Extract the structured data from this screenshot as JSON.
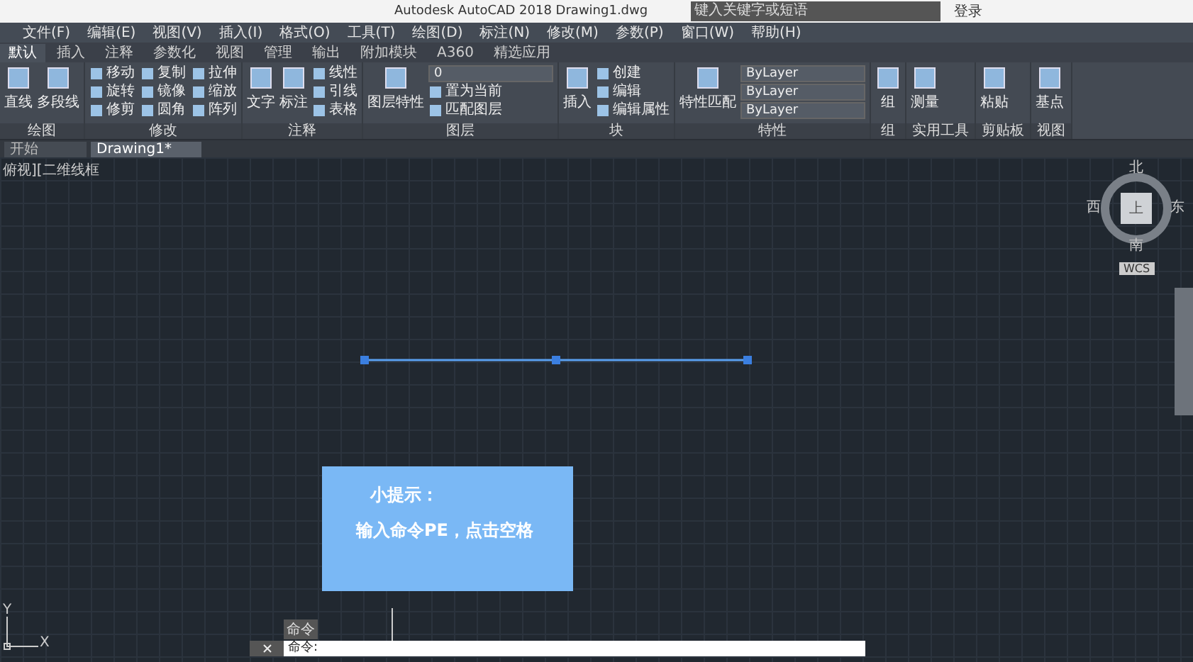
{
  "title_bar": {
    "title": "Autodesk AutoCAD 2018    Drawing1.dwg",
    "search_placeholder": "键入关键字或短语",
    "user": "登录"
  },
  "menu": [
    "文件(F)",
    "编辑(E)",
    "视图(V)",
    "插入(I)",
    "格式(O)",
    "工具(T)",
    "绘图(D)",
    "标注(N)",
    "修改(M)",
    "参数(P)",
    "窗口(W)",
    "帮助(H)"
  ],
  "ribbon_tabs": [
    {
      "label": "默认",
      "selected": true
    },
    {
      "label": "插入",
      "selected": false
    },
    {
      "label": "注释",
      "selected": false
    },
    {
      "label": "参数化",
      "selected": false
    },
    {
      "label": "视图",
      "selected": false
    },
    {
      "label": "管理",
      "selected": false
    },
    {
      "label": "输出",
      "selected": false
    },
    {
      "label": "附加模块",
      "selected": false
    },
    {
      "label": "A360",
      "selected": false
    },
    {
      "label": "精选应用",
      "selected": false
    }
  ],
  "panels": [
    {
      "title": "绘图",
      "items": [
        {
          "kind": "big",
          "label": "直线"
        },
        {
          "kind": "big",
          "label": "多段线"
        }
      ]
    },
    {
      "title": "修改",
      "items": [
        {
          "kind": "small",
          "label": "移动"
        },
        {
          "kind": "small",
          "label": "旋转"
        },
        {
          "kind": "small",
          "label": "修剪"
        },
        {
          "kind": "small",
          "label": "复制"
        },
        {
          "kind": "small",
          "label": "镜像"
        },
        {
          "kind": "small",
          "label": "圆角"
        },
        {
          "kind": "small",
          "label": "拉伸"
        },
        {
          "kind": "small",
          "label": "缩放"
        },
        {
          "kind": "small",
          "label": "阵列"
        }
      ]
    },
    {
      "title": "注释",
      "items": [
        {
          "kind": "big",
          "label": "文字"
        },
        {
          "kind": "big",
          "label": "标注"
        },
        {
          "kind": "small",
          "label": "线性"
        },
        {
          "kind": "small",
          "label": "引线"
        },
        {
          "kind": "small",
          "label": "表格"
        }
      ]
    },
    {
      "title": "图层",
      "items": [
        {
          "kind": "big",
          "label": "图层特性"
        },
        {
          "kind": "dropdown",
          "label": "0"
        },
        {
          "kind": "small",
          "label": "置为当前"
        },
        {
          "kind": "small",
          "label": "匹配图层"
        }
      ]
    },
    {
      "title": "块",
      "items": [
        {
          "kind": "big",
          "label": "插入"
        },
        {
          "kind": "small",
          "label": "创建"
        },
        {
          "kind": "small",
          "label": "编辑"
        },
        {
          "kind": "small",
          "label": "编辑属性"
        }
      ]
    },
    {
      "title": "特性",
      "items": [
        {
          "kind": "big",
          "label": "特性匹配"
        },
        {
          "kind": "dropdown",
          "label": "ByLayer"
        },
        {
          "kind": "dropdown",
          "label": "ByLayer"
        },
        {
          "kind": "dropdown",
          "label": "ByLayer"
        }
      ]
    },
    {
      "title": "组",
      "items": [
        {
          "kind": "big",
          "label": "组"
        }
      ]
    },
    {
      "title": "实用工具",
      "items": [
        {
          "kind": "big",
          "label": "测量"
        }
      ]
    },
    {
      "title": "剪贴板",
      "items": [
        {
          "kind": "big",
          "label": "粘贴"
        }
      ]
    },
    {
      "title": "视图",
      "items": [
        {
          "kind": "big",
          "label": "基点"
        }
      ]
    }
  ],
  "file_tabs": [
    {
      "label": "开始",
      "selected": false
    },
    {
      "label": "Drawing1*",
      "selected": true
    }
  ],
  "viewport_label": "俯视][二维线框",
  "viewcube": {
    "north": "北",
    "east": "东",
    "south": "南",
    "west": "西",
    "top": "上",
    "wcs": "WCS"
  },
  "tip": {
    "title": "小提示：",
    "body": "输入命令PE，点击空格"
  },
  "command_line": {
    "tab": "命令",
    "prompt": "命令:"
  },
  "ucs": {
    "x": "X",
    "y": "Y"
  }
}
